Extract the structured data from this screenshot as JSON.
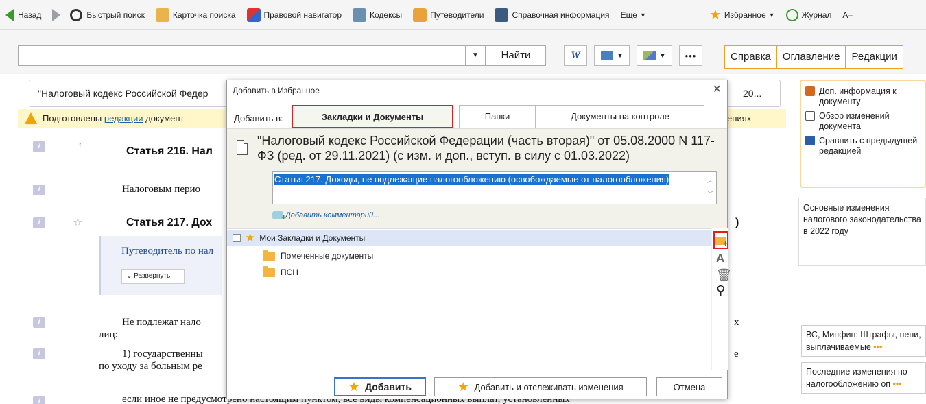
{
  "toolbar": {
    "back": "Назад",
    "quick_search": "Быстрый поиск",
    "search_card": "Карточка поиска",
    "legal_navigator": "Правовой навигатор",
    "codes": "Кодексы",
    "guides": "Путеводители",
    "reference": "Справочная информация",
    "more": "Еще",
    "favorites": "Избранное",
    "journal": "Журнал",
    "font_size": "A–"
  },
  "search": {
    "value": "",
    "find_button": "Найти"
  },
  "right_tabs": [
    "Справка",
    "Оглавление",
    "Редакции"
  ],
  "document": {
    "title": "\"Налоговый кодекс Российской Федер",
    "title_tail": "20...",
    "warning_prefix": "Подготовлены ",
    "warning_link": "редакции",
    "warning_suffix": " документ",
    "warning_tail": "ениях",
    "article_216": "Статья 216. Нал",
    "tax_period": "Налоговым перио",
    "article_217": "Статья 217. Дох",
    "article_217_tail": ")",
    "guide_link": "Путеводитель по нал",
    "expand": "Развернуть",
    "p1": "Не подлежат нало",
    "p1_tail": "х",
    "p1_line2": "лиц:",
    "p2": "1) государственны",
    "p2_tail": "е",
    "p2_line2": "по уходу за больным ре",
    "p3": "если иное не предусмотрено настоящим пунктом, все виды компенсационных выплат, установленных",
    "badge": "i"
  },
  "right_panel": {
    "items": [
      "Доп. информация к документу",
      "Обзор изменений документа",
      "Сравнить с предыдущей редакцией"
    ],
    "note": "Основные изменения налогового законодательства в 2022 году",
    "card1": "ВС, Минфин: Штрафы, пени, выплачиваемые",
    "card2": "Последние изменения по налогообложению оп"
  },
  "modal": {
    "title": "Добавить в Избранное",
    "add_to_label": "Добавить в:",
    "tabs": [
      "Закладки и Документы",
      "Папки",
      "Документы на контроле"
    ],
    "doc_title": "\"Налоговый кодекс Российской Федерации (часть вторая)\" от 05.08.2000 N 117-ФЗ (ред. от 29.11.2021) (с изм. и доп., вступ. в силу с 01.03.2022)",
    "selected_text": "Статья 217. Доходы, не подлежащие налогообложению (освобождаемые от налогообложения)",
    "add_comment": "Добавить комментарий...",
    "tree": [
      "Мои Закладки и Документы",
      "Помеченные документы",
      "ПСН"
    ],
    "buttons": {
      "add": "Добавить",
      "add_track": "Добавить и отслеживать изменения",
      "cancel": "Отмена"
    }
  },
  "colors": {
    "accent_orange": "#f0a020",
    "highlight_red": "#e02020",
    "selection_blue": "#1a72d0",
    "warning_bg": "#fff6c9"
  }
}
